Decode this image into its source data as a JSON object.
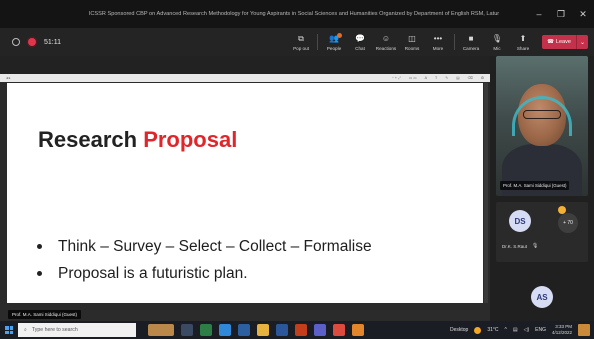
{
  "window": {
    "title": "ICSSR Sponsored CBP on Advanced Research Methodology for Young Aspirants in Social Sciences and Humanities Organized by Department of English RSM, Latur",
    "minimize": "–",
    "maximize": "❐",
    "close": "✕"
  },
  "toolbar": {
    "timer": "51:11",
    "buttons": [
      {
        "label": "Pop out",
        "icon": "⧉"
      },
      {
        "label": "People",
        "icon": "👥"
      },
      {
        "label": "Chat",
        "icon": "💬"
      },
      {
        "label": "Reactions",
        "icon": "☺"
      },
      {
        "label": "Rooms",
        "icon": "◫"
      },
      {
        "label": "More",
        "icon": "•••"
      },
      {
        "label": "Camera",
        "icon": "■"
      },
      {
        "label": "Mic",
        "icon": "🎙"
      },
      {
        "label": "Share",
        "icon": "⬆"
      }
    ],
    "leave_label": "Leave",
    "leave_icon": "☎",
    "leave_dropdown": "⌄"
  },
  "slide": {
    "title_part1": "Research ",
    "title_part2": "Proposal",
    "bullets": [
      "Think – Survey – Select – Collect – Formalise",
      "Proposal is a futuristic plan."
    ]
  },
  "presenter": {
    "stage_name": "Prof. M.A. Sami Siddiqui (Guest)"
  },
  "participants": {
    "video_name": "Prof. M.A. Sami Siddiqui (Guest)",
    "tile_initials": "DS",
    "tile_name": "Dr.K. S.Raut",
    "more_count": "+ 70",
    "bottom_initials": "AS"
  },
  "taskbar": {
    "search_placeholder": "Type here to search",
    "desktop_label": "Desktop",
    "weather": "31°C",
    "lang": "ENG",
    "time": "3:33 PM",
    "date": "4/12/2022"
  },
  "colors": {
    "accent_red": "#e0262b",
    "leave": "#c4314b",
    "avatar_bg": "#d5dcf3"
  }
}
